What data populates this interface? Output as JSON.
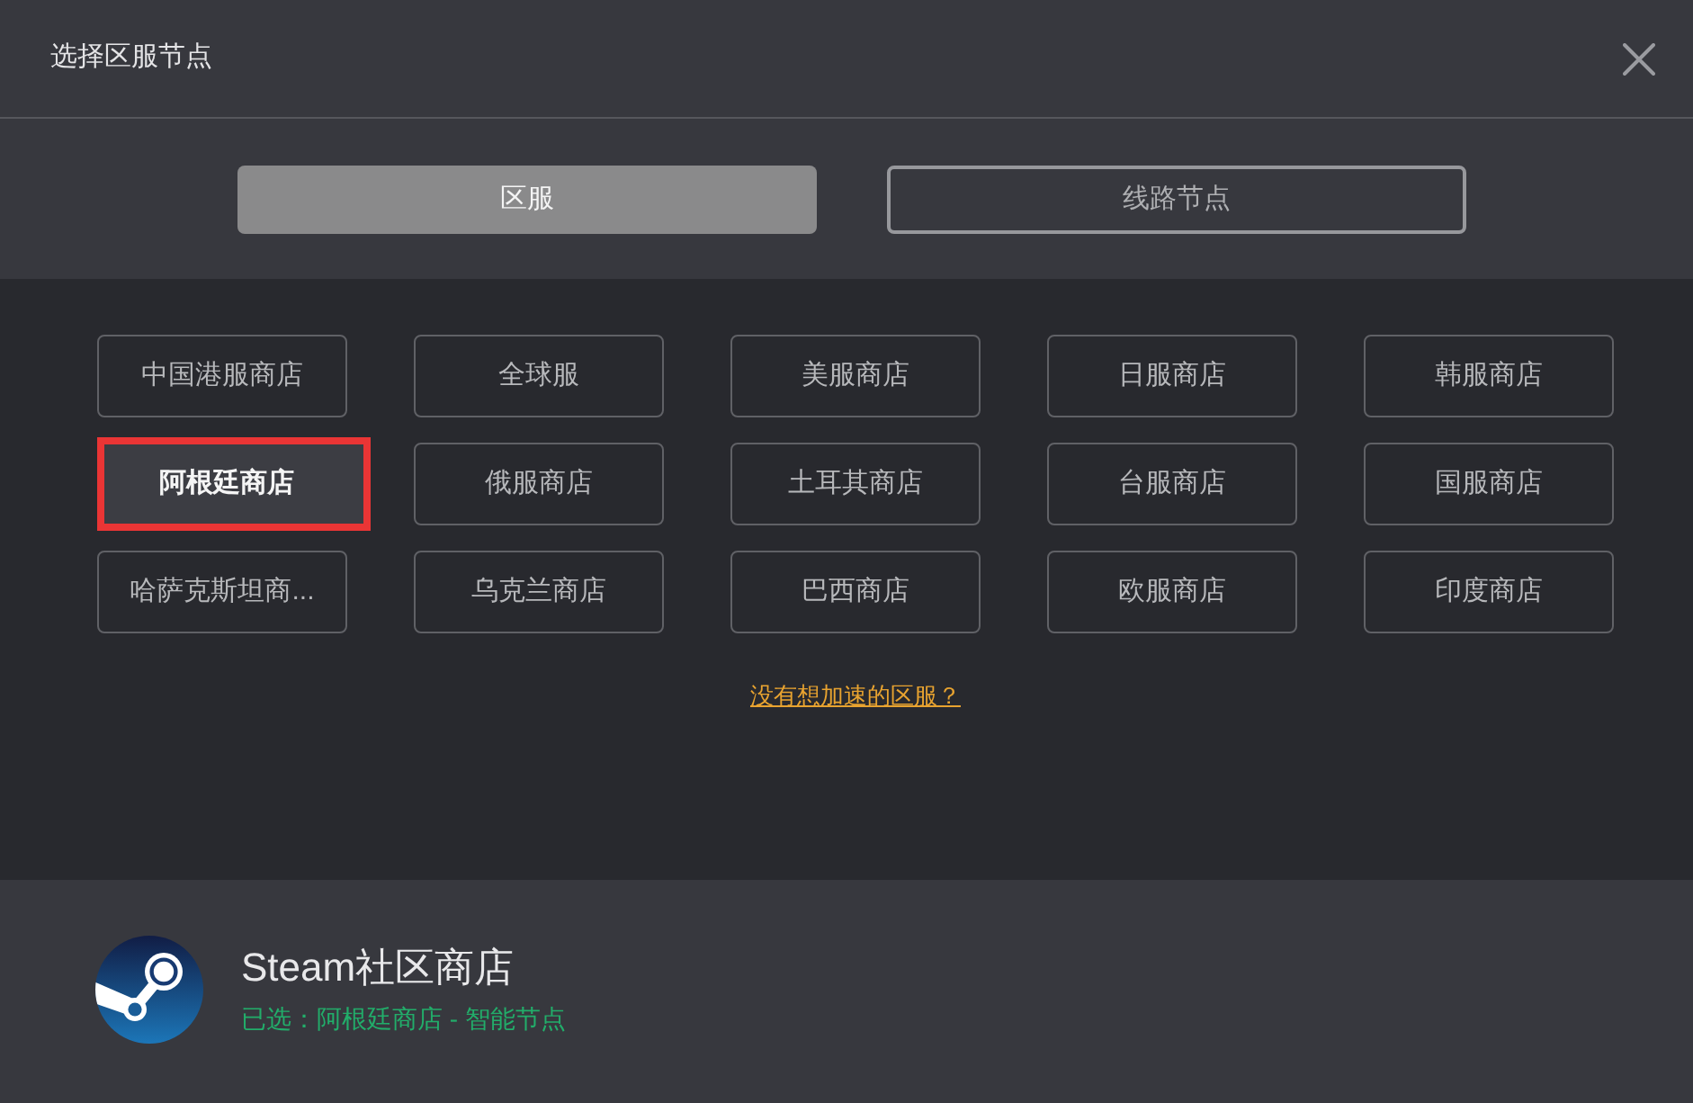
{
  "window": {
    "title": "选择区服节点"
  },
  "tabs": [
    {
      "label": "区服",
      "selected": true
    },
    {
      "label": "线路节点",
      "selected": false
    }
  ],
  "regions": [
    {
      "label": "中国港服商店",
      "selected": false
    },
    {
      "label": "全球服",
      "selected": false
    },
    {
      "label": "美服商店",
      "selected": false
    },
    {
      "label": "日服商店",
      "selected": false
    },
    {
      "label": "韩服商店",
      "selected": false
    },
    {
      "label": "阿根廷商店",
      "selected": true
    },
    {
      "label": "俄服商店",
      "selected": false
    },
    {
      "label": "土耳其商店",
      "selected": false
    },
    {
      "label": "台服商店",
      "selected": false
    },
    {
      "label": "国服商店",
      "selected": false
    },
    {
      "label": "哈萨克斯坦商...",
      "selected": false
    },
    {
      "label": "乌克兰商店",
      "selected": false
    },
    {
      "label": "巴西商店",
      "selected": false
    },
    {
      "label": "欧服商店",
      "selected": false
    },
    {
      "label": "印度商店",
      "selected": false
    }
  ],
  "help_link": "没有想加速的区服？",
  "game": {
    "title": "Steam社区商店",
    "status": "已选：阿根廷商店 - 智能节点"
  }
}
